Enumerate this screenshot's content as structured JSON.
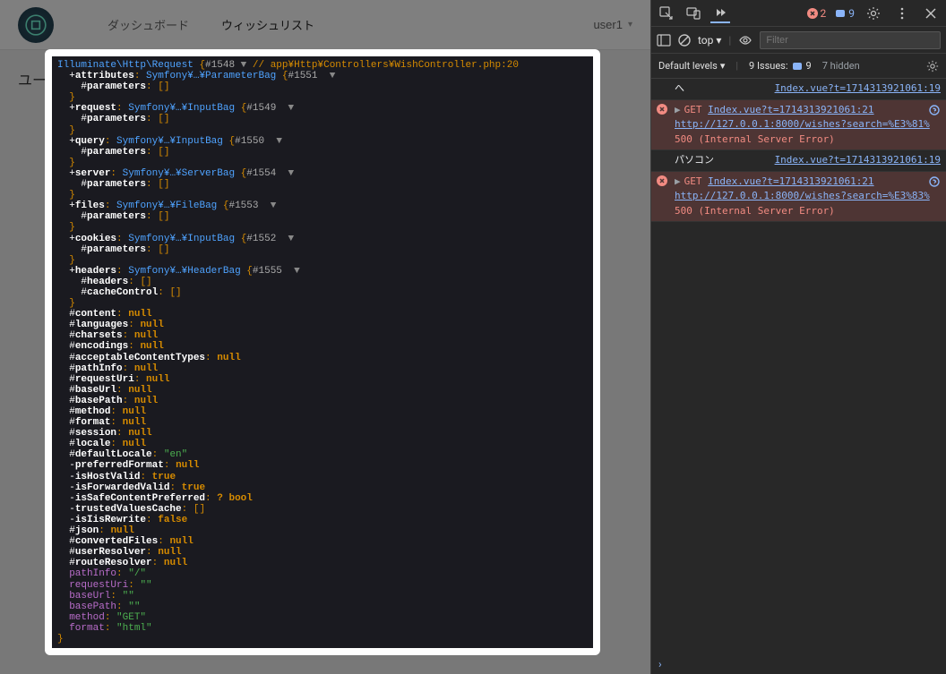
{
  "app": {
    "nav": {
      "dashboard": "ダッシュボード",
      "wishlist": "ウィッシュリスト"
    },
    "user": "user1",
    "page_heading": "ユー"
  },
  "dump": {
    "class": "Illuminate\\Http\\Request",
    "ref": "#1548",
    "comment": "// app¥Http¥Controllers¥WishController.php:20",
    "attributes": {
      "label": "attributes",
      "type": "Symfony¥…¥ParameterBag",
      "ref": "#1551",
      "param": "parameters"
    },
    "request": {
      "label": "request",
      "type": "Symfony¥…¥InputBag",
      "ref": "#1549",
      "param": "parameters"
    },
    "query": {
      "label": "query",
      "type": "Symfony¥…¥InputBag",
      "ref": "#1550",
      "param": "parameters"
    },
    "server": {
      "label": "server",
      "type": "Symfony¥…¥ServerBag",
      "ref": "#1554",
      "param": "parameters"
    },
    "files": {
      "label": "files",
      "type": "Symfony¥…¥FileBag",
      "ref": "#1553",
      "param": "parameters"
    },
    "cookies": {
      "label": "cookies",
      "type": "Symfony¥…¥InputBag",
      "ref": "#1552",
      "param": "parameters"
    },
    "headers": {
      "label": "headers",
      "type": "Symfony¥…¥HeaderBag",
      "ref": "#1555",
      "param": "headers",
      "extra": "cacheControl"
    },
    "scalars": [
      {
        "k": "content",
        "p": "#",
        "v": "null"
      },
      {
        "k": "languages",
        "p": "#",
        "v": "null"
      },
      {
        "k": "charsets",
        "p": "#",
        "v": "null"
      },
      {
        "k": "encodings",
        "p": "#",
        "v": "null"
      },
      {
        "k": "acceptableContentTypes",
        "p": "#",
        "v": "null"
      },
      {
        "k": "pathInfo",
        "p": "#",
        "v": "null"
      },
      {
        "k": "requestUri",
        "p": "#",
        "v": "null"
      },
      {
        "k": "baseUrl",
        "p": "#",
        "v": "null"
      },
      {
        "k": "basePath",
        "p": "#",
        "v": "null"
      },
      {
        "k": "method",
        "p": "#",
        "v": "null"
      },
      {
        "k": "format",
        "p": "#",
        "v": "null"
      },
      {
        "k": "session",
        "p": "#",
        "v": "null"
      },
      {
        "k": "locale",
        "p": "#",
        "v": "null"
      },
      {
        "k": "defaultLocale",
        "p": "#",
        "v": "\"en\"",
        "t": "str"
      },
      {
        "k": "preferredFormat",
        "p": "-",
        "v": "null"
      },
      {
        "k": "isHostValid",
        "p": "-",
        "v": "true",
        "t": "bool"
      },
      {
        "k": "isForwardedValid",
        "p": "-",
        "v": "true",
        "t": "bool"
      },
      {
        "k": "isSafeContentPreferred",
        "p": "-",
        "v": "? bool",
        "t": "bool"
      },
      {
        "k": "trustedValuesCache",
        "p": "-",
        "v": "[]",
        "t": "arr"
      },
      {
        "k": "isIisRewrite",
        "p": "-",
        "v": "false",
        "t": "bool"
      },
      {
        "k": "json",
        "p": "#",
        "v": "null"
      },
      {
        "k": "convertedFiles",
        "p": "#",
        "v": "null"
      },
      {
        "k": "userResolver",
        "p": "#",
        "v": "null"
      },
      {
        "k": "routeResolver",
        "p": "#",
        "v": "null"
      }
    ],
    "computed": [
      {
        "k": "pathInfo",
        "v": "\"/\""
      },
      {
        "k": "requestUri",
        "v": "\"\""
      },
      {
        "k": "baseUrl",
        "v": "\"\""
      },
      {
        "k": "basePath",
        "v": "\"\""
      },
      {
        "k": "method",
        "v": "\"GET\""
      },
      {
        "k": "format",
        "v": "\"html\""
      }
    ]
  },
  "devtools": {
    "errors": "2",
    "warnings": "9",
    "top": "top",
    "filter_placeholder": "Filter",
    "levels": "Default levels",
    "issues_label": "9 Issues:",
    "issues_count": "9",
    "hidden": "7 hidden",
    "messages": [
      {
        "type": "log",
        "text": "へ",
        "src": "Index.vue?t=1714313921061:19"
      },
      {
        "type": "error",
        "method": "GET",
        "src": "Index.vue?t=1714313921061:21",
        "url": "http://127.0.0.1:8000/wishes?search=%E3%81%",
        "status": "500 (Internal Server Error)"
      },
      {
        "type": "log",
        "text": "パソコン",
        "src": "Index.vue?t=1714313921061:19"
      },
      {
        "type": "error",
        "method": "GET",
        "src": "Index.vue?t=1714313921061:21",
        "url": "http://127.0.0.1:8000/wishes?search=%E3%83%",
        "status": "500 (Internal Server Error)"
      }
    ]
  }
}
